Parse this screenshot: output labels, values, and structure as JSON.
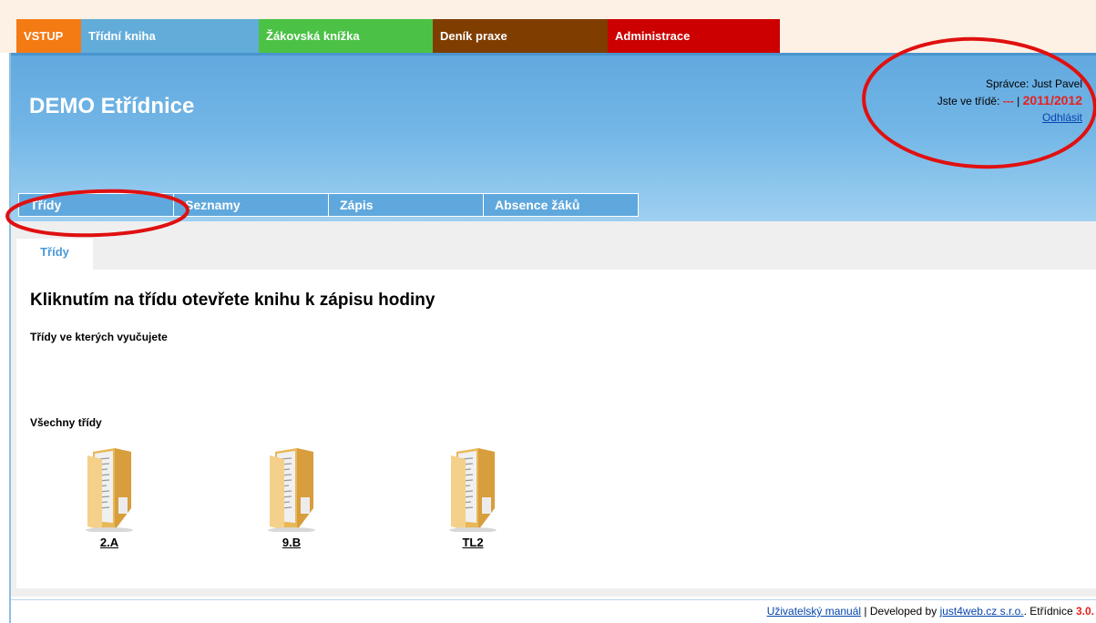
{
  "topnav": {
    "items": [
      {
        "label": "VSTUP",
        "color": "#f47a14"
      },
      {
        "label": "Třídní kniha",
        "color": "#62acd9"
      },
      {
        "label": "Žákovská knížka",
        "color": "#4bc245"
      },
      {
        "label": "Deník praxe",
        "color": "#7f3d00"
      },
      {
        "label": "Administrace",
        "color": "#cc0000"
      }
    ]
  },
  "header": {
    "app_title": "DEMO Etřídnice",
    "admin_label": "Správce: Just Pavel",
    "class_prefix": "Jste ve třídě:",
    "class_value": "---",
    "separator": "|",
    "school_year": "2011/2012",
    "logout": "Odhlásit"
  },
  "subnav": {
    "items": [
      "Třídy",
      "Seznamy",
      "Zápis",
      "Absence žáků"
    ]
  },
  "content": {
    "active_tab": "Třídy",
    "heading": "Kliknutím na třídu otevřete knihu k zápisu hodiny",
    "section_teaching": "Třídy ve kterých vyučujete",
    "section_all": "Všechny třídy",
    "classes": [
      "2.A",
      "9.B",
      "TL2"
    ]
  },
  "footer": {
    "manual": "Uživatelský manuál",
    "developed_by": " | Developed by ",
    "company": "just4web.cz s.r.o.",
    "product": ". Etřídnice ",
    "version": "3.0."
  },
  "colors": {
    "header_blue": "#62a9df",
    "accent_red": "#e8201e",
    "annotation_red": "#e01010"
  }
}
